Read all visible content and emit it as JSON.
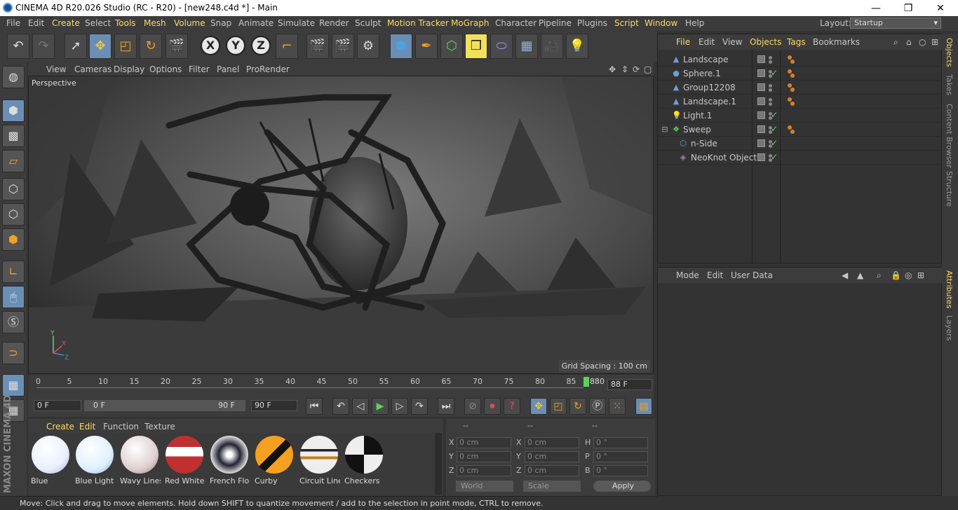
{
  "window": {
    "title": "CINEMA 4D R20.026 Studio (RC - R20) - [new248.c4d *] - Main",
    "min": "—",
    "max": "❐",
    "close": "✕"
  },
  "menu": {
    "items": [
      "File",
      "Edit",
      "Create",
      "Select",
      "Tools",
      "Mesh",
      "Volume",
      "Snap",
      "Animate",
      "Simulate",
      "Render",
      "Sculpt",
      "Motion Tracker",
      "MoGraph",
      "Character",
      "Pipeline",
      "Plugins",
      "Script",
      "Window",
      "Help"
    ],
    "layout_label": "Layout:",
    "layout_value": "Startup"
  },
  "viewport": {
    "menu": [
      "View",
      "Cameras",
      "Display",
      "Options",
      "Filter",
      "Panel",
      "ProRender"
    ],
    "label": "Perspective",
    "grid_spacing": "Grid Spacing : 100 cm",
    "axis_x": "X",
    "axis_y": "Y",
    "axis_z": "Z"
  },
  "timeline": {
    "ticks": [
      "0",
      "5",
      "10",
      "15",
      "20",
      "25",
      "30",
      "35",
      "40",
      "45",
      "50",
      "55",
      "60",
      "65",
      "70",
      "75",
      "80",
      "85"
    ],
    "current": "880",
    "end_field": "88 F"
  },
  "transport": {
    "start": "0 F",
    "min": "0 F",
    "max": "90 F",
    "end": "90 F"
  },
  "materials": {
    "menu": [
      "Create",
      "Edit",
      "Function",
      "Texture"
    ],
    "items": [
      {
        "name": "Blue"
      },
      {
        "name": "Blue Light"
      },
      {
        "name": "Wavy Lines"
      },
      {
        "name": "Red White"
      },
      {
        "name": "French Flo"
      },
      {
        "name": "Curby"
      },
      {
        "name": "Circuit Line"
      },
      {
        "name": "Checkers"
      }
    ]
  },
  "coords": {
    "headers": [
      "--",
      "--",
      "--"
    ],
    "rows": [
      {
        "a": "X",
        "av": "0 cm",
        "b": "X",
        "bv": "0 cm",
        "c": "H",
        "cv": "0 °"
      },
      {
        "a": "Y",
        "av": "0 cm",
        "b": "Y",
        "bv": "0 cm",
        "c": "P",
        "cv": "0 °"
      },
      {
        "a": "Z",
        "av": "0 cm",
        "b": "Z",
        "bv": "0 cm",
        "c": "B",
        "cv": "0 °"
      }
    ],
    "world": "World",
    "scale": "Scale",
    "apply": "Apply"
  },
  "objects": {
    "menu": [
      "File",
      "Edit",
      "View",
      "Objects",
      "Tags",
      "Bookmarks"
    ],
    "rows": [
      {
        "name": "Landscape"
      },
      {
        "name": "Sphere.1"
      },
      {
        "name": "Group12208"
      },
      {
        "name": "Landscape.1"
      },
      {
        "name": "Light.1"
      },
      {
        "name": "Sweep"
      },
      {
        "name": "n-Side"
      },
      {
        "name": "NeoKnot Object"
      }
    ]
  },
  "attributes": {
    "menu": [
      "Mode",
      "Edit",
      "User Data"
    ]
  },
  "side_tabs": {
    "top": [
      "Objects",
      "Takes",
      "Content Browser",
      "Structure"
    ],
    "bottom": [
      "Attributes",
      "Layers"
    ]
  },
  "status": "Move: Click and drag to move elements. Hold down SHIFT to quantize movement / add to the selection in point mode, CTRL to remove.",
  "brand": "MAXON CINEMA 4D"
}
